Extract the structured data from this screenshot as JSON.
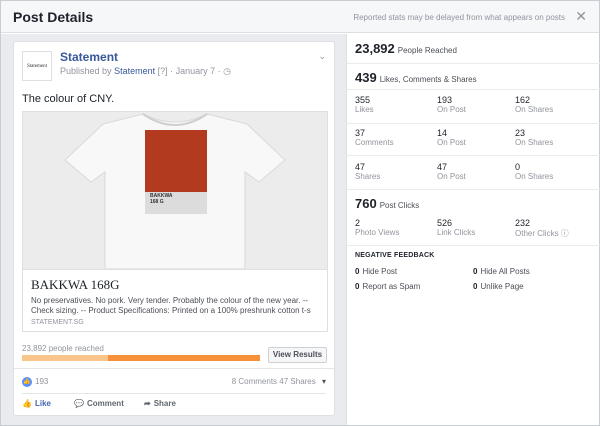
{
  "header": {
    "title": "Post Details",
    "note": "Reported stats may be delayed from what appears on posts",
    "close": "✕"
  },
  "post": {
    "logo_text": "Statement",
    "page_name": "Statement",
    "published_prefix": "Published by",
    "published_by": "Statement",
    "published_suffix": "[?] · January 7 · ◷",
    "caption": "The colour of CNY.",
    "shirt_print": "BAKKWA\n168 G",
    "link_title": "BAKKWA 168G",
    "link_desc": "No preservatives. No pork. Very tender. Probably the colour of the new year. -- Check sizing. -- Product Specifications: Printed on a 100% preshrunk cotton t-s",
    "link_domain": "STATEMENT.SG",
    "reach_label": "23,892 people reached",
    "reach_organic_fraction": 0.36,
    "view_results": "View Results",
    "likes_count": "193",
    "comments": "8 Comments",
    "shares": "47 Shares",
    "actions": {
      "like": "Like",
      "comment": "Comment",
      "share": "Share"
    }
  },
  "stats": {
    "people_reached": {
      "value": "23,892",
      "label": "People Reached"
    },
    "engagement": {
      "value": "439",
      "label": "Likes, Comments & Shares"
    },
    "grid": [
      [
        {
          "value": "355",
          "label": "Likes"
        },
        {
          "value": "193",
          "label": "On Post"
        },
        {
          "value": "162",
          "label": "On Shares"
        }
      ],
      [
        {
          "value": "37",
          "label": "Comments"
        },
        {
          "value": "14",
          "label": "On Post"
        },
        {
          "value": "23",
          "label": "On Shares"
        }
      ],
      [
        {
          "value": "47",
          "label": "Shares"
        },
        {
          "value": "47",
          "label": "On Post"
        },
        {
          "value": "0",
          "label": "On Shares"
        }
      ]
    ],
    "post_clicks": {
      "value": "760",
      "label": "Post Clicks"
    },
    "clicks": [
      {
        "value": "2",
        "label": "Photo Views"
      },
      {
        "value": "526",
        "label": "Link Clicks"
      },
      {
        "value": "232",
        "label": "Other Clicks ⓘ"
      }
    ],
    "negative_title": "NEGATIVE FEEDBACK",
    "negative": [
      {
        "value": "0",
        "label": "Hide Post"
      },
      {
        "value": "0",
        "label": "Hide All Posts"
      },
      {
        "value": "0",
        "label": "Report as Spam"
      },
      {
        "value": "0",
        "label": "Unlike Page"
      }
    ]
  },
  "colors": {
    "link": "#365899",
    "accent": "#4267b2",
    "reach_paid": "#f7923a",
    "reach_organic": "#f9c58d",
    "swatch": "#b23a1e"
  }
}
